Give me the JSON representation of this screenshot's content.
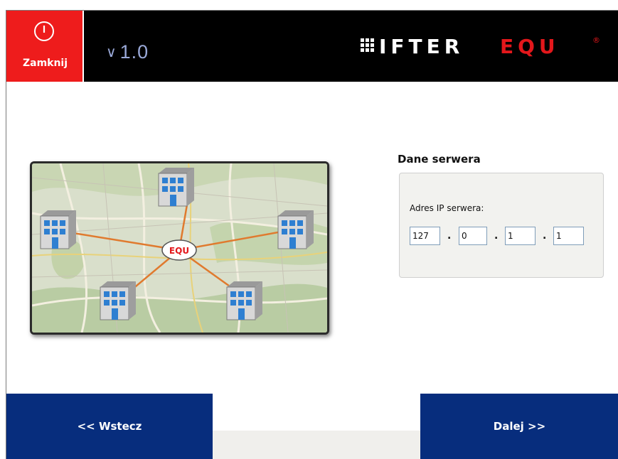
{
  "header": {
    "close_label": "Zamknij",
    "version_chevron": "∨",
    "version_number": "1.0",
    "logo_text_white": "IFTER",
    "logo_text_red": "EQU",
    "registered_mark": "®"
  },
  "colors": {
    "header_bg": "#000000",
    "close_bg": "#ee1c1c",
    "nav_button_bg": "#072d7d",
    "logo_red": "#e3171b",
    "version_color": "#9aa9d8"
  },
  "map": {
    "hub_label": "EQU",
    "building_count": 5
  },
  "server": {
    "section_title": "Dane serwera",
    "ip_label": "Adres IP serwera:",
    "ip_octets": [
      "127",
      "0",
      "1",
      "1"
    ],
    "separator": "."
  },
  "footer": {
    "back_label": "<< Wstecz",
    "next_label": "Dalej >>"
  }
}
